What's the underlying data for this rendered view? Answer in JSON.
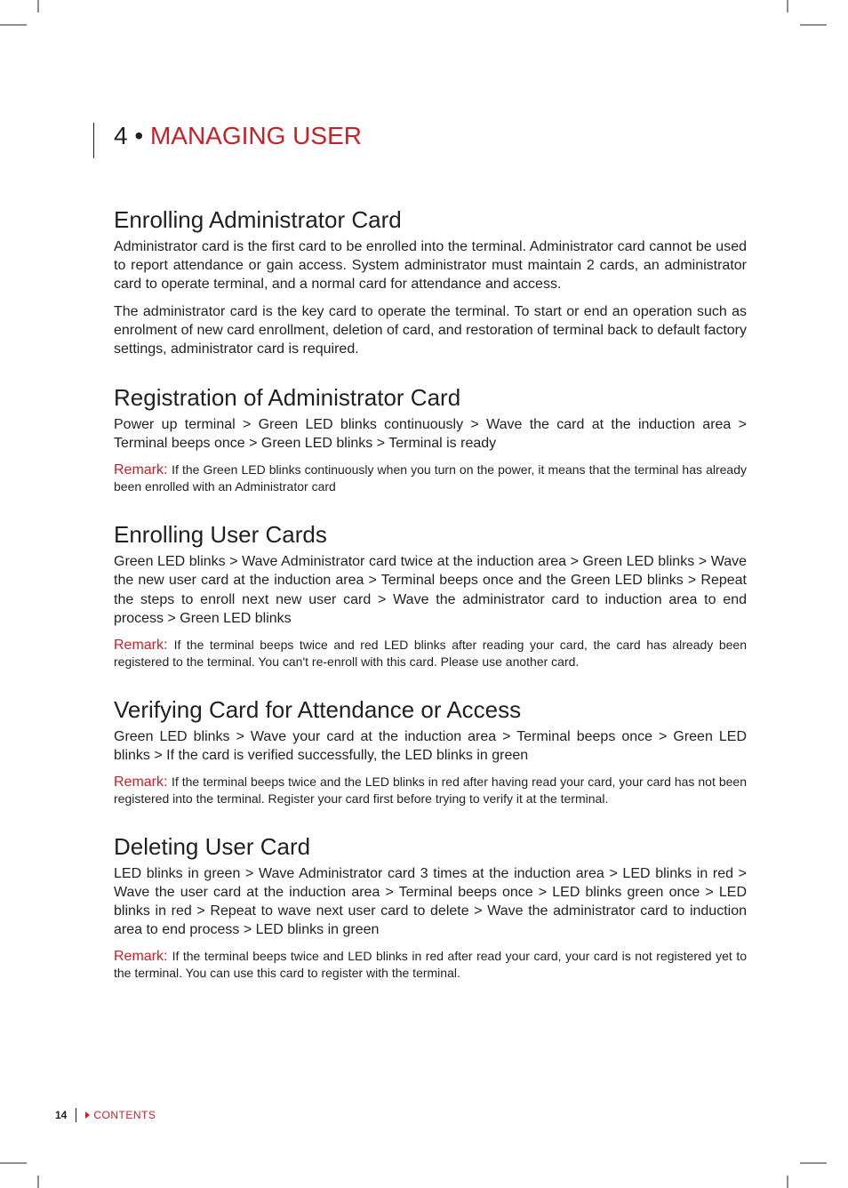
{
  "chapter": {
    "num": "4 •",
    "title": "MANAGING USER"
  },
  "sections": [
    {
      "heading": "Enrolling Administrator Card",
      "paras": [
        "Administrator card is the first card to be enrolled into the terminal. Administrator card cannot be used to report attendance or gain access. System administrator must maintain 2 cards, an administrator card to operate terminal, and a normal card for attendance and access.",
        "The administrator card is the key card to operate the terminal. To start or end an operation such as enrolment of new card enrollment, deletion of card, and restoration of terminal back to default factory settings, administrator card is required."
      ],
      "remark": null
    },
    {
      "heading": "Registration of Administrator Card",
      "paras": [
        "Power up terminal > Green LED blinks continuously > Wave the card at the induction area > Terminal beeps once > Green LED blinks > Terminal is ready"
      ],
      "remark": {
        "label": "Remark:",
        "text": "If the Green LED blinks continuously when you turn on the power, it means that the terminal has already been enrolled with an Administrator card"
      }
    },
    {
      "heading": "Enrolling User Cards",
      "paras": [
        "Green LED blinks > Wave Administrator card twice at the induction area > Green LED blinks > Wave the new user card at the induction area > Terminal beeps once and the Green LED blinks > Repeat the steps to enroll next new user card > Wave the administrator card to induction area to end process > Green LED blinks"
      ],
      "remark": {
        "label": "Remark:",
        "text": "If the terminal beeps twice and red LED blinks after reading your card, the card has already been registered to the terminal. You can't re-enroll with this card. Please use another card."
      }
    },
    {
      "heading": "Verifying Card for Attendance or Access",
      "paras": [
        "Green LED blinks > Wave your card at the induction area > Terminal beeps once > Green LED blinks  > If the card is verified successfully, the LED blinks in green"
      ],
      "remark": {
        "label": "Remark:",
        "text": "If the terminal beeps twice and the LED blinks in red after having read your card, your card has not been registered into the terminal. Register your card first before trying to verify it at the terminal."
      }
    },
    {
      "heading": "Deleting User Card",
      "paras": [
        "LED blinks in green > Wave Administrator card 3 times at the induction area > LED blinks in red > Wave the user card at the induction area > Terminal beeps once > LED blinks green once > LED blinks in red > Repeat to wave next user card to delete > Wave the administrator card to induction area to end process > LED blinks in green"
      ],
      "remark": {
        "label": "Remark:",
        "text": "If the terminal beeps twice and LED blinks in red after read your card, your card is not registered yet to the terminal. You can use this card to register with the terminal."
      }
    }
  ],
  "footer": {
    "page": "14",
    "contents": "CONTENTS"
  }
}
